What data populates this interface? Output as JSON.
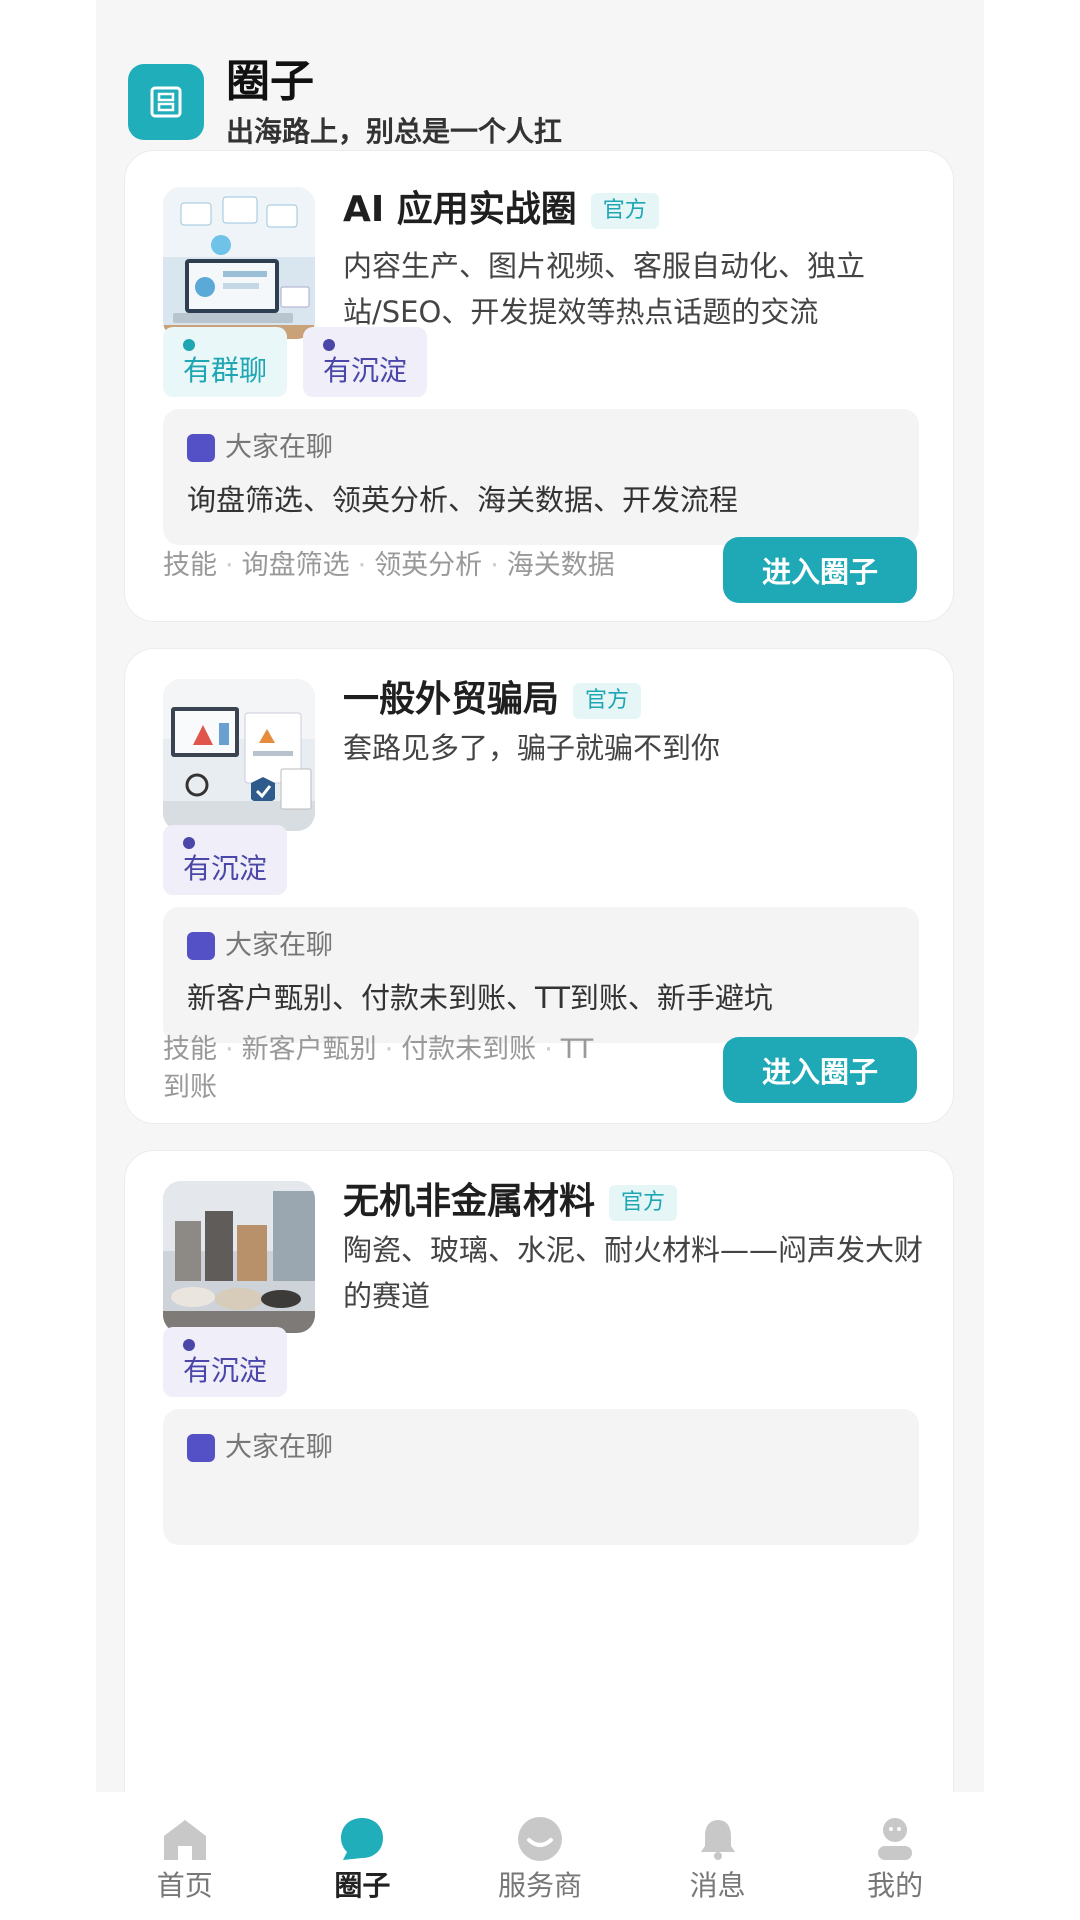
{
  "header": {
    "title": "圈子",
    "subtitle": "出海路上，别总是一个人扛"
  },
  "cards": [
    {
      "title": "AI 应用实战圈",
      "badge": "官方",
      "desc": "内容生产、图片视频、客服自动化、独立站/SEO、开发提效等热点话题的交流",
      "tags": [
        "有群聊",
        "有沉淀"
      ],
      "talk_label": "大家在聊",
      "talk_text": "询盘筛选、领英分析、海关数据、开发流程",
      "keywords": [
        "技能",
        "询盘筛选",
        "领英分析",
        "海关数据"
      ],
      "button": "进入圈子"
    },
    {
      "title": "一般外贸骗局",
      "badge": "官方",
      "desc": "套路见多了，骗子就骗不到你",
      "tags": [
        "有沉淀"
      ],
      "talk_label": "大家在聊",
      "talk_text": "新客户甄别、付款未到账、TT到账、新手避坑",
      "keywords": [
        "技能",
        "新客户甄别",
        "付款未到账",
        "TT到账"
      ],
      "button": "进入圈子"
    },
    {
      "title": "无机非金属材料",
      "badge": "官方",
      "desc": "陶瓷、玻璃、水泥、耐火材料——闷声发大财的赛道",
      "tags": [
        "有沉淀"
      ],
      "talk_label": "大家在聊"
    }
  ],
  "nav": [
    {
      "label": "首页",
      "icon": "home-icon"
    },
    {
      "label": "圈子",
      "icon": "circle-chat-icon",
      "active": true
    },
    {
      "label": "服务商",
      "icon": "service-icon"
    },
    {
      "label": "消息",
      "icon": "bell-icon"
    },
    {
      "label": "我的",
      "icon": "profile-icon"
    }
  ],
  "colors": {
    "accent": "#1fa9b6",
    "settle_tag": "#4a47a8",
    "talk_square": "#5450c6"
  }
}
